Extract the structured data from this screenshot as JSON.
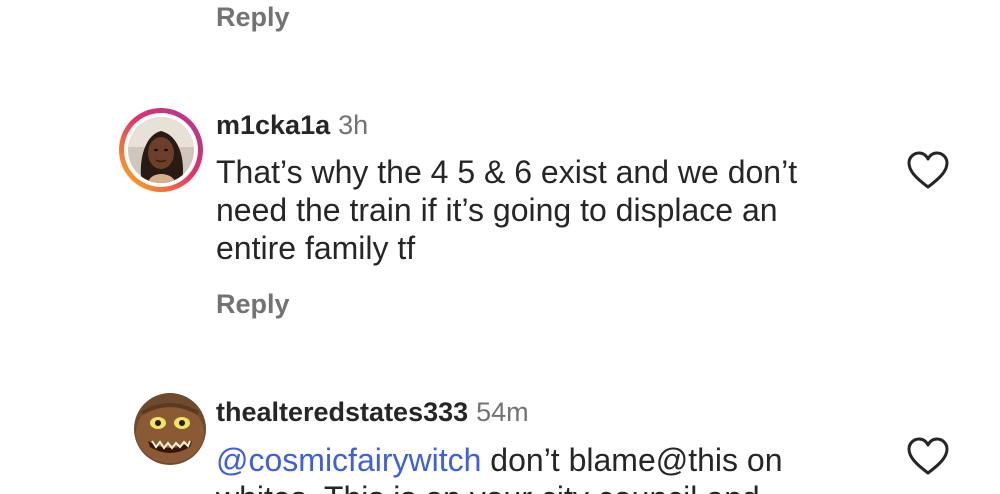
{
  "top_reply": {
    "label": "Reply"
  },
  "comments": [
    {
      "username": "m1cka1a",
      "time": "3h",
      "text": "That’s why the 4 5 & 6 exist and we don’t need the train if it’s going to displace an entire family tf",
      "reply_label": "Reply",
      "has_story_ring": true,
      "heart_icon": "heart-outline-icon"
    },
    {
      "username": "thealteredstates333",
      "time": "54m",
      "mention": "@cosmicfairywitch",
      "text": " don’t blame@this on whites. This is on your city council and",
      "has_story_ring": false,
      "heart_icon": "heart-outline-icon"
    }
  ],
  "colors": {
    "reply_gray": "#737373",
    "mention_blue": "#3f5ee0",
    "text": "#262626"
  }
}
